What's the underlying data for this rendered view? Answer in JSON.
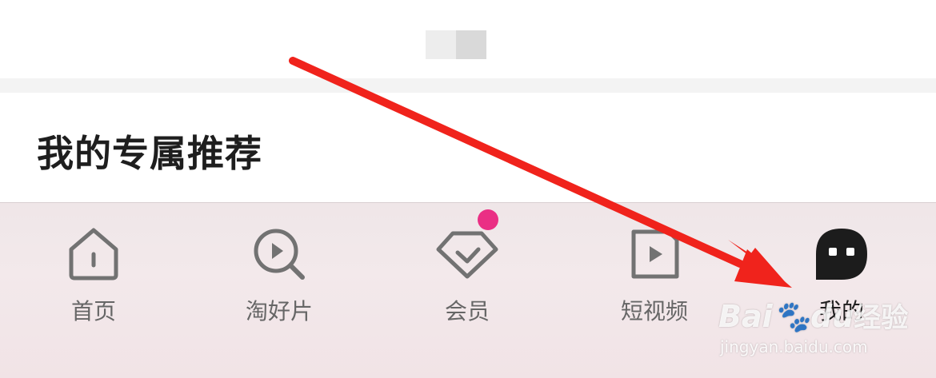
{
  "section": {
    "title": "我的专属推荐"
  },
  "tabbar": {
    "items": [
      {
        "id": "home",
        "label": "首页",
        "icon": "home-icon",
        "active": false
      },
      {
        "id": "discover",
        "label": "淘好片",
        "icon": "search-play-icon",
        "active": false
      },
      {
        "id": "vip",
        "label": "会员",
        "icon": "diamond-icon",
        "active": false,
        "badge": true
      },
      {
        "id": "short-video",
        "label": "短视频",
        "icon": "play-square-icon",
        "active": false
      },
      {
        "id": "me",
        "label": "我的",
        "icon": "profile-face-icon",
        "active": true
      }
    ]
  },
  "watermark": {
    "brand": "Bai",
    "brand_suffix": "du",
    "brand_zh": "经验",
    "url": "jingyan.baidu.com"
  },
  "colors": {
    "badge": "#ea2f84",
    "arrow": "#f0231c",
    "icon_inactive": "#727272",
    "icon_active": "#1c1c1c"
  }
}
